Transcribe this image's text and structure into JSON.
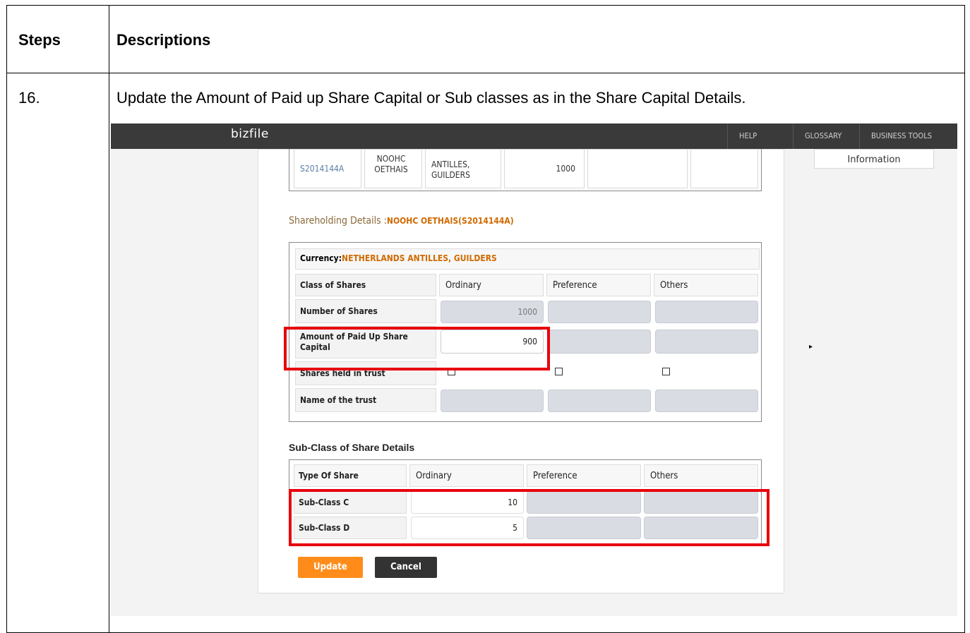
{
  "doc": {
    "header_steps": "Steps",
    "header_desc": "Descriptions",
    "step_number": "16.",
    "step_text": "Update the Amount of Paid up Share Capital or Sub classes as in the Share Capital Details."
  },
  "app": {
    "logo": "bizfile",
    "nav": {
      "help": "HELP",
      "glossary": "GLOSSARY",
      "tools": "BUSINESS TOOLS"
    },
    "side_text": "Information",
    "side_arrow": "▸"
  },
  "prev_row": {
    "id": "S2014144A",
    "name": "NOOHC OETHAIS",
    "currency": "ANTILLES, GUILDERS",
    "count": "1000"
  },
  "holding": {
    "label": "Shareholding Details :",
    "value": "NOOHC OETHAIS(S2014144A)"
  },
  "shares": {
    "currency_label": "Currency:",
    "currency_value": "NETHERLANDS ANTILLES, GUILDERS",
    "headers": [
      "Class of Shares",
      "Ordinary",
      "Preference",
      "Others"
    ],
    "row_labels": {
      "number": "Number of Shares",
      "amount": "Amount of Paid Up Share Capital",
      "trust": "Shares held in trust",
      "trust_name": "Name of the trust"
    },
    "number_ordinary": "1000",
    "amount_ordinary": "900"
  },
  "subclass": {
    "title": "Sub-Class of Share Details",
    "headers": [
      "Type Of Share",
      "Ordinary",
      "Preference",
      "Others"
    ],
    "rows": [
      {
        "label": "Sub-Class C",
        "ordinary": "10"
      },
      {
        "label": "Sub-Class D",
        "ordinary": "5"
      }
    ]
  },
  "buttons": {
    "update": "Update",
    "cancel": "Cancel"
  },
  "colors": {
    "highlight": "#e8000b",
    "accent": "#ff8c1a"
  }
}
